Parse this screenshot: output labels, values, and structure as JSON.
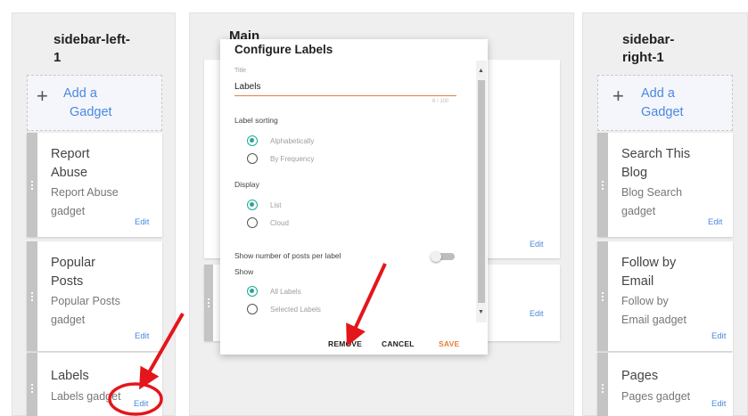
{
  "columns": {
    "left": {
      "title_line1": "sidebar-left-",
      "title_line2": "1"
    },
    "main": {
      "title": "Main"
    },
    "right": {
      "title_line1": "sidebar-",
      "title_line2": "right-1"
    }
  },
  "add_gadget": {
    "plus": "+",
    "line1": "Add a",
    "line2": "Gadget"
  },
  "left_gadgets": [
    {
      "title_line1": "Report",
      "title_line2": "Abuse",
      "desc_line1": "Report Abuse",
      "desc_line2": "gadget",
      "edit": "Edit"
    },
    {
      "title_line1": "Popular",
      "title_line2": "Posts",
      "desc_line1": "Popular Posts",
      "desc_line2": "gadget",
      "edit": "Edit"
    },
    {
      "title_line1": "Labels",
      "desc_line1": "Labels gadget",
      "edit": "Edit"
    }
  ],
  "right_gadgets": [
    {
      "title_line1": "Search This",
      "title_line2": "Blog",
      "desc_line1": "Blog Search",
      "desc_line2": "gadget",
      "edit": "Edit"
    },
    {
      "title_line1": "Follow by",
      "title_line2": "Email",
      "desc_line1": "Follow by",
      "desc_line2": "Email gadget",
      "edit": "Edit"
    },
    {
      "title_line1": "Pages",
      "desc_line1": "Pages gadget",
      "edit": "Edit"
    }
  ],
  "main_cards": [
    {
      "edit": "Edit"
    },
    {
      "edit": "Edit"
    }
  ],
  "dialog": {
    "title": "Configure Labels",
    "title_field_label": "Title",
    "title_value": "Labels",
    "char_counter": "6 / 100",
    "sorting_label": "Label sorting",
    "sorting_options": [
      {
        "label": "Alphabetically",
        "selected": true
      },
      {
        "label": "By Frequency",
        "selected": false
      }
    ],
    "display_label": "Display",
    "display_options": [
      {
        "label": "List",
        "selected": true
      },
      {
        "label": "Cloud",
        "selected": false
      }
    ],
    "show_count_label": "Show number of posts per label",
    "show_count_enabled": false,
    "show_label": "Show",
    "show_options": [
      {
        "label": "All Labels",
        "selected": true
      },
      {
        "label": "Selected Labels",
        "selected": false
      }
    ],
    "buttons": {
      "remove": "REMOVE",
      "cancel": "CANCEL",
      "save": "SAVE"
    }
  },
  "colors": {
    "accent_orange": "#e67e3b",
    "link_blue": "#4a88e0",
    "radio_teal": "#26a69a",
    "annotation_red": "#e3161b"
  }
}
